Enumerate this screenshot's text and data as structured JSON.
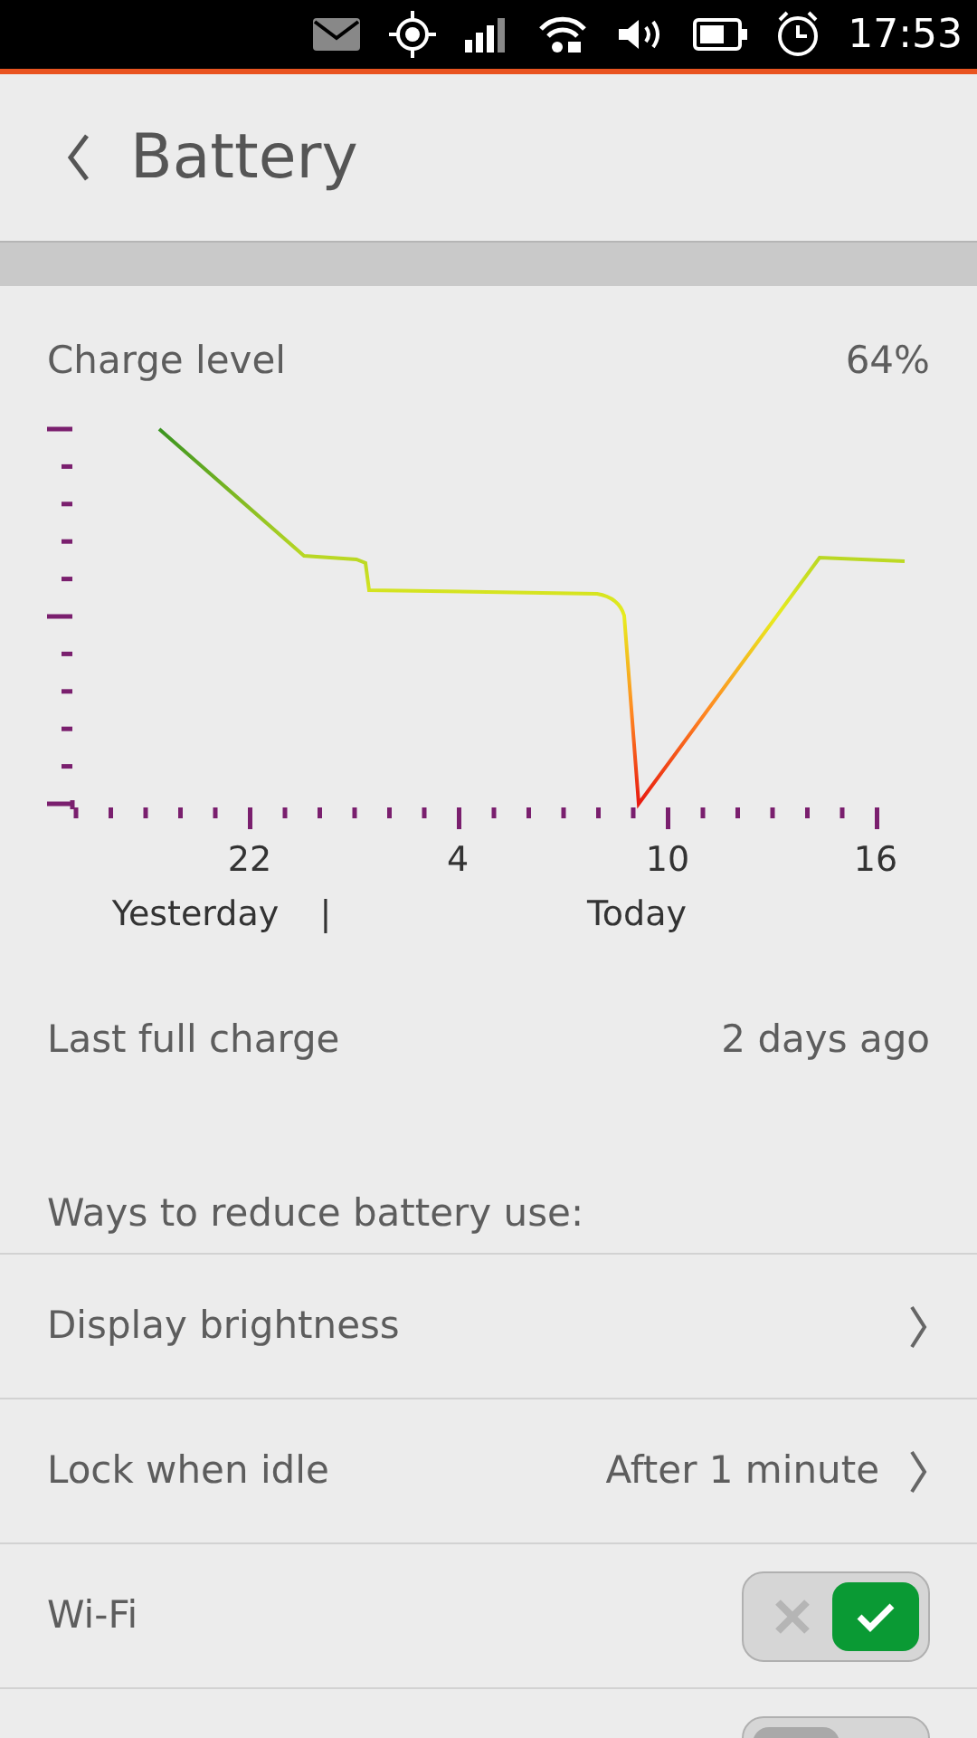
{
  "status_bar": {
    "time": "17:53"
  },
  "header": {
    "title": "Battery"
  },
  "charge": {
    "label": "Charge level",
    "value": "64%"
  },
  "graph": {
    "hour_labels": [
      "22",
      "4",
      "10",
      "16"
    ],
    "day_labels": [
      "Yesterday",
      "|",
      "Today"
    ]
  },
  "last_full_charge": {
    "label": "Last full charge",
    "value": "2 days ago"
  },
  "section_title": "Ways to reduce battery use:",
  "rows": [
    {
      "kind": "link",
      "label": "Display brightness"
    },
    {
      "kind": "link",
      "label": "Lock when idle",
      "value": "After 1 minute"
    },
    {
      "kind": "switch",
      "label": "Wi-Fi",
      "on": true
    },
    {
      "kind": "switch",
      "on": false
    }
  ]
}
